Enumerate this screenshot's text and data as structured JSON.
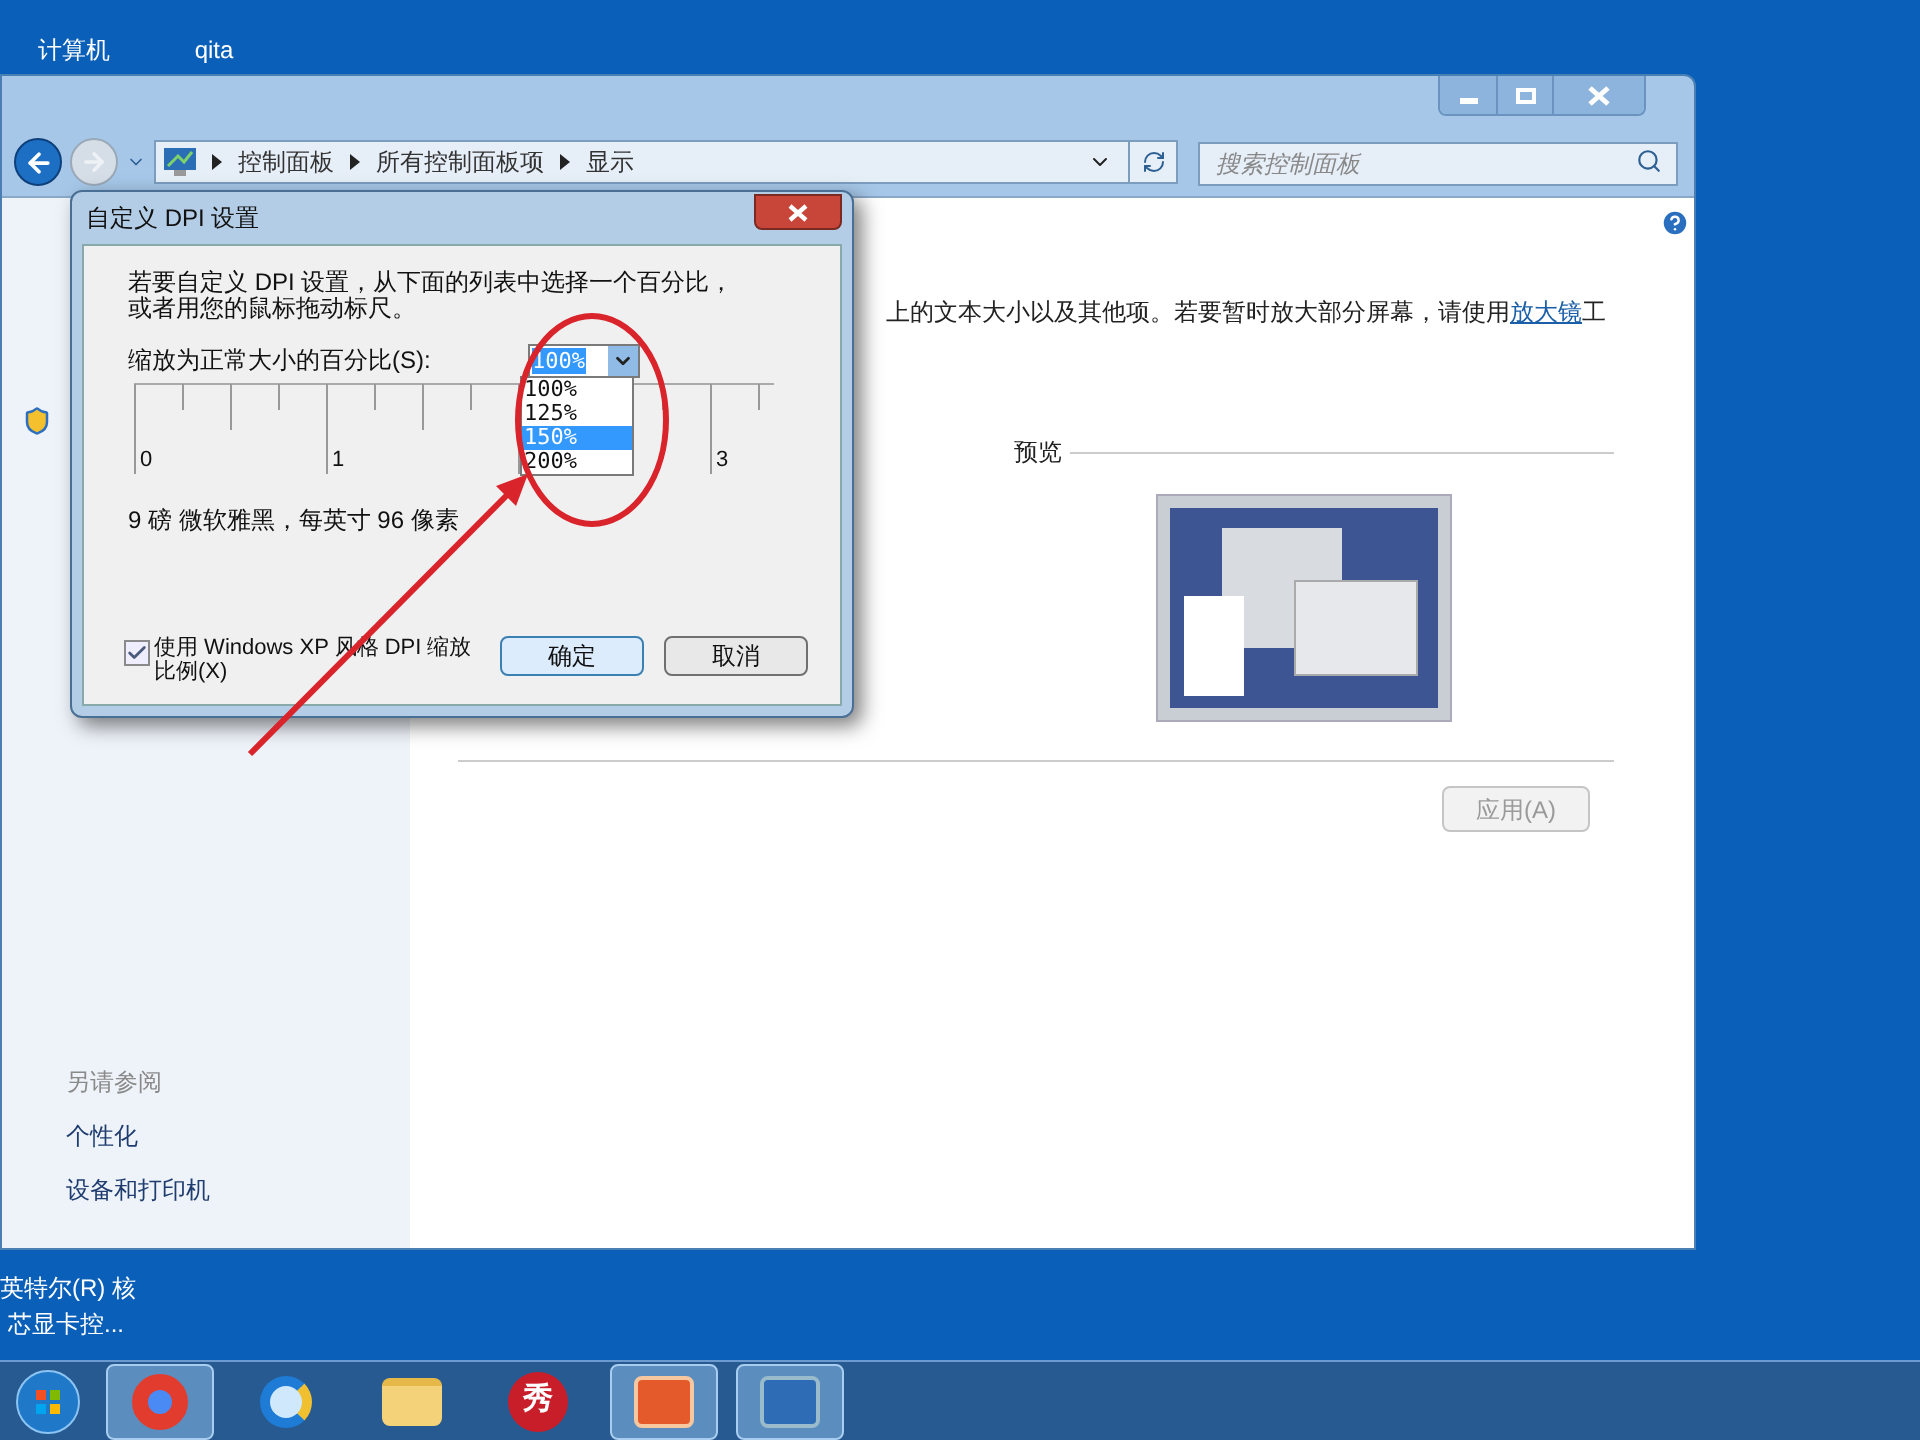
{
  "desktop_icons": [
    {
      "label": "计算机"
    },
    {
      "label": "qita"
    }
  ],
  "window": {
    "address": {
      "crumbs": [
        "控制面板",
        "所有控制面板项",
        "显示"
      ]
    },
    "search": {
      "placeholder": "搜索控制面板"
    },
    "sidebar": {
      "see_also": "另请参阅",
      "links": [
        "个性化",
        "设备和打印机"
      ]
    },
    "description": "上的文本大小以及其他项。若要暂时放大部分屏幕，请使用",
    "link": "放大镜",
    "description_end": "工",
    "preview_label": "预览",
    "apply_button": {
      "label": "应用(A)",
      "disabled": true
    }
  },
  "dialog": {
    "title": "自定义 DPI 设置",
    "instruction": "若要自定义 DPI 设置，从下面的列表中选择一个百分比，或者用您的鼠标拖动标尺。",
    "scale_label": "缩放为正常大小的百分比(S):",
    "combo_value": "100%",
    "options": [
      {
        "label": "100%",
        "selected": false
      },
      {
        "label": "125%",
        "selected": false
      },
      {
        "label": "150%",
        "selected": true
      },
      {
        "label": "200%",
        "selected": false
      }
    ],
    "ruler_labels": [
      "0",
      "1",
      "3"
    ],
    "font_info": "9 磅 微软雅黑，每英寸 96 像素",
    "xp_checkbox": {
      "label": "使用 Windows XP 风格 DPI 缩放比例(X)",
      "checked": true
    },
    "buttons": [
      {
        "label": "确定",
        "default": true
      },
      {
        "label": "取消",
        "default": false
      }
    ]
  },
  "desktop_label": [
    "英特尔(R) 核",
    "芯显卡控..."
  ],
  "taskbar": {
    "badge_text": "秀"
  }
}
